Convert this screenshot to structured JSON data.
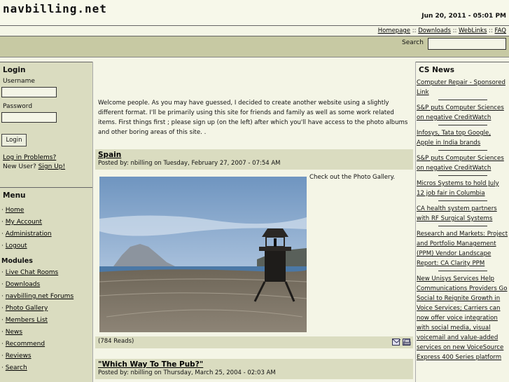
{
  "site": {
    "logo": "navbilling.net",
    "datetime": "Jun 20, 2011 - 05:01 PM"
  },
  "topnav": {
    "items": [
      "Homepage",
      "Downloads",
      "WebLinks",
      "FAQ"
    ],
    "separator": "::"
  },
  "search": {
    "label": "Search",
    "value": ""
  },
  "login": {
    "title": "Login",
    "username_label": "Username",
    "password_label": "Password",
    "button": "Login",
    "problems": "Log in Problems?",
    "new_user": "New User?",
    "signup": "Sign Up!"
  },
  "menu": {
    "title": "Menu",
    "bullet": "·",
    "items": [
      "Home",
      "My Account",
      "Administration",
      "Logout"
    ],
    "modules_title": "Modules",
    "modules": [
      "Live Chat Rooms",
      "Downloads",
      "navbilling.net Forums",
      "Photo Gallery",
      "Members List",
      "News",
      "Recommend",
      "Reviews",
      "Search"
    ]
  },
  "welcome": "Welcome people. As you may have guessed, I decided to create another website using a slightly different format. I'll be primarily using this site for friends and family as well as some work related items. First things first ; please sign up (on the left) after which you'll have access to the photo albums and other boring areas of this site. .",
  "stories": [
    {
      "title": "Spain",
      "meta": "Posted by: nbilling on Tuesday, February 27, 2007 - 07:54 AM",
      "caption": "Check out the Photo Gallery.",
      "reads": "(784 Reads)"
    },
    {
      "title": "\"Which Way To The Pub?\"",
      "meta": "Posted by: nbilling on Thursday, March 25, 2004 - 02:03 AM"
    }
  ],
  "icons": {
    "email": "email-icon",
    "print": "print-icon"
  },
  "cs_news": {
    "title": "CS News",
    "items": [
      "Computer Repair - Sponsored Link",
      "S&P puts Computer Sciences on negative CreditWatch",
      "Infosys, Tata top Google, Apple in India brands",
      "S&P puts Computer Sciences on negative CreditWatch",
      "Micros Systems to hold July 12 job fair in Columbia",
      "CA health system partners with RF Surgical Systems",
      "Research and Markets: Project and Portfolio Management (PPM) Vendor Landscape Report: CA Clarity PPM",
      "New Unisys Services Help Communications Providers Go Social to Reignite Growth in Voice Services; Carriers can now offer voice integration with social media, visual voicemail and value-added services on new VoiceSource Express 400 Series platform"
    ]
  }
}
